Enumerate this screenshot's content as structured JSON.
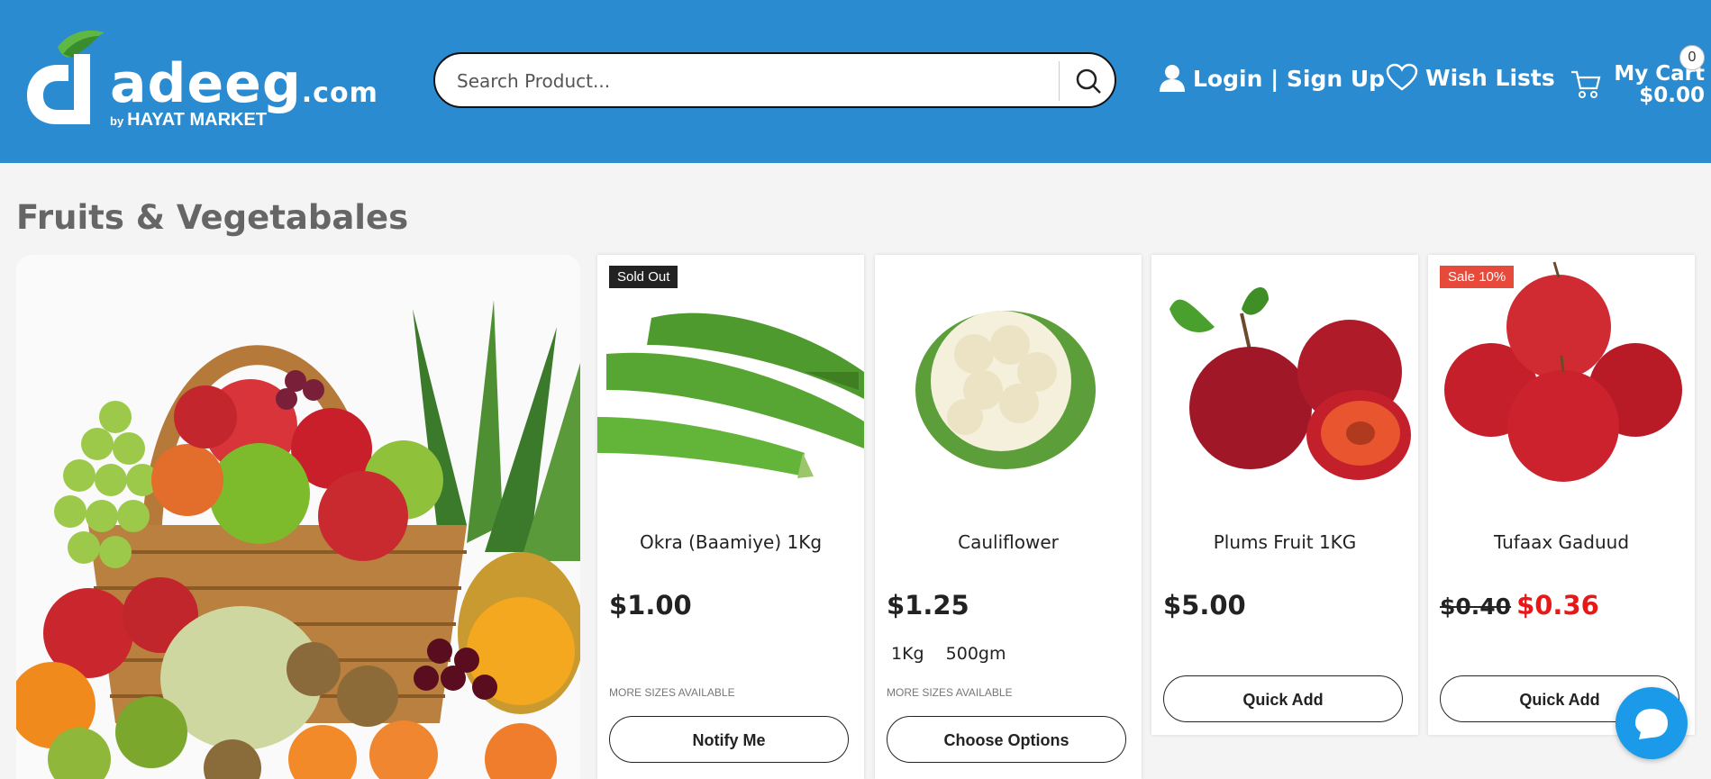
{
  "brand": {
    "name": "adeeg",
    "tld": ".com",
    "sub_by": "by",
    "sub_name": "HAYAT MARKET",
    "primary_color": "#2a8bd0"
  },
  "search": {
    "placeholder": "Search Product..."
  },
  "header_nav": {
    "login_label": "Login | Sign Up",
    "wishlist_label": "Wish Lists",
    "cart_label": "My Cart",
    "cart_total": "$0.00",
    "cart_count": "0"
  },
  "section": {
    "title": "Fruits & Vegetabales"
  },
  "products": [
    {
      "name": "Okra (Baamiye) 1Kg",
      "badge": "Sold Out",
      "price": "$1.00",
      "more": "MORE SIZES AVAILABLE",
      "button": "Notify Me"
    },
    {
      "name": "Cauliflower",
      "price": "$1.25",
      "sizes": [
        "1Kg",
        "500gm"
      ],
      "more": "MORE SIZES AVAILABLE",
      "button": "Choose Options"
    },
    {
      "name": "Plums Fruit 1KG",
      "price": "$5.00",
      "button": "Quick Add"
    },
    {
      "name": "Tufaax Gaduud",
      "badge": "Sale 10%",
      "old_price": "$0.40",
      "price": "$0.36",
      "button": "Quick Add"
    }
  ],
  "colors": {
    "sold_badge": "#222222",
    "sale_badge": "#e74a3b",
    "sale_price": "#e81818",
    "chat_button": "#1a9ae8"
  }
}
